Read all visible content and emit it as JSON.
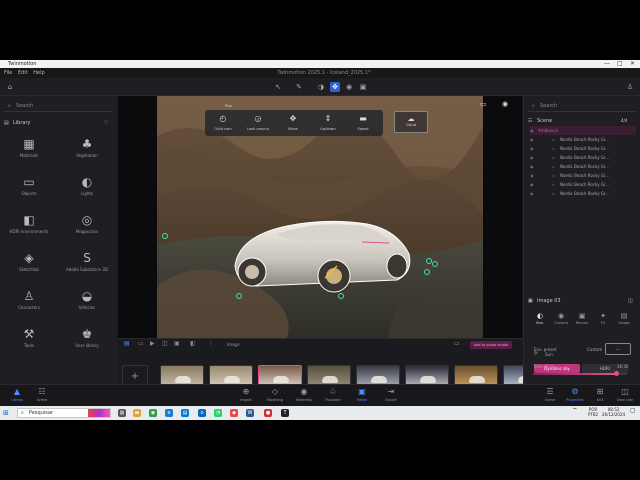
{
  "window": {
    "title": "Twinmotion",
    "controls": [
      "—",
      "□",
      "✕"
    ]
  },
  "menu": {
    "items": [
      "File",
      "Edit",
      "Help"
    ],
    "document_title": "Twinmotion 2025.1 - Iceland_2025.1*"
  },
  "left_panel": {
    "search_placeholder": "Search",
    "library_title": "Library",
    "items": [
      {
        "label": "Materials",
        "icon": "materials-icon",
        "glyph": "▦"
      },
      {
        "label": "Vegetation",
        "icon": "vegetation-icon",
        "glyph": "♣"
      },
      {
        "label": "Objects",
        "icon": "objects-icon",
        "glyph": "▭"
      },
      {
        "label": "Lights",
        "icon": "lights-icon",
        "glyph": "◐"
      },
      {
        "label": "HDRI environments",
        "icon": "hdri-icon",
        "glyph": "◧"
      },
      {
        "label": "Megascans",
        "icon": "megascans-icon",
        "glyph": "◎"
      },
      {
        "label": "Sketchfab",
        "icon": "sketchfab-icon",
        "glyph": "◈"
      },
      {
        "label": "Adobe Substance 3D",
        "icon": "substance-icon",
        "glyph": "S"
      },
      {
        "label": "Characters",
        "icon": "characters-icon",
        "glyph": "♙"
      },
      {
        "label": "Vehicles",
        "icon": "vehicles-icon",
        "glyph": "◒"
      },
      {
        "label": "Tools",
        "icon": "tools-icon",
        "glyph": "⚒"
      },
      {
        "label": "User library",
        "icon": "user-library-icon",
        "glyph": "♚"
      }
    ]
  },
  "viewport_tools": [
    {
      "label": "Orbit cam",
      "glyph": "◴"
    },
    {
      "label": "Look around",
      "glyph": "◶"
    },
    {
      "label": "Move",
      "glyph": "✥"
    },
    {
      "label": "Up/down",
      "glyph": "⇕"
    },
    {
      "label": "Speed",
      "glyph": "▬"
    }
  ],
  "viewport": {
    "plus_label": "Plus",
    "cloud_label": "Cloud"
  },
  "strip": {
    "section_label": "Image",
    "action_label": "Add to photo studio",
    "images": [
      "Image 01",
      "Image 02",
      "Image 03",
      "Image 04",
      "Image 05",
      "Image 06",
      "Image 07",
      "Image 08",
      "Image 09"
    ]
  },
  "right_panel": {
    "search_placeholder": "Search",
    "scene_title": "Scene",
    "scene_count": "4/4",
    "root": "Ambiance",
    "items": [
      "Nordic Beach Rocky Gr...",
      "Nordic Beach Rocky Gr...",
      "Nordic Beach Rocky Gr...",
      "Nordic Beach Rocky Gr...",
      "Nordic Beach Rocky Gr...",
      "Nordic Beach Rocky Gr...",
      "Nordic Beach Rocky Gr..."
    ],
    "image_title": "Image 03",
    "tabs": [
      "Env.",
      "Camera",
      "Render",
      "FX",
      "Image"
    ],
    "env_preset_label": "Env. preset",
    "custom_label": "Custom",
    "dynamic_sky": "Dynamic sky",
    "hdri": "HDRI",
    "sun_label": "Sun",
    "time_of_day_label": "Time of day",
    "time_value": "16:30",
    "north_offset_label": "North offset",
    "north_value": "49°",
    "time_fraction": 0.88,
    "north_fraction": 0.1,
    "appearance_label": "Appearance",
    "location_label": "Location"
  },
  "dock": {
    "left": [
      {
        "label": "Library",
        "glyph": "▲"
      },
      {
        "label": "Scene",
        "glyph": "☷"
      }
    ],
    "center": [
      {
        "label": "Import",
        "glyph": "⊕"
      },
      {
        "label": "Modeling",
        "glyph": "◇"
      },
      {
        "label": "Materials",
        "glyph": "◉"
      },
      {
        "label": "Populate",
        "glyph": "♧"
      },
      {
        "label": "Media",
        "glyph": "▣"
      },
      {
        "label": "Export",
        "glyph": "⇥"
      }
    ],
    "right": [
      {
        "label": "Scene",
        "glyph": "☰"
      },
      {
        "label": "Properties",
        "glyph": "⚙"
      },
      {
        "label": "XYZ",
        "glyph": "⊞"
      },
      {
        "label": "View cam",
        "glyph": "◫"
      }
    ]
  },
  "taskbar": {
    "search_placeholder": "Pesquisar",
    "lang": "POR",
    "layout": "PTB2",
    "time": "08:52",
    "date": "26/12/2024"
  },
  "colors": {
    "accent_blue": "#2a66d8",
    "accent_pink": "#e0508f",
    "panel": "#1f1f23"
  }
}
